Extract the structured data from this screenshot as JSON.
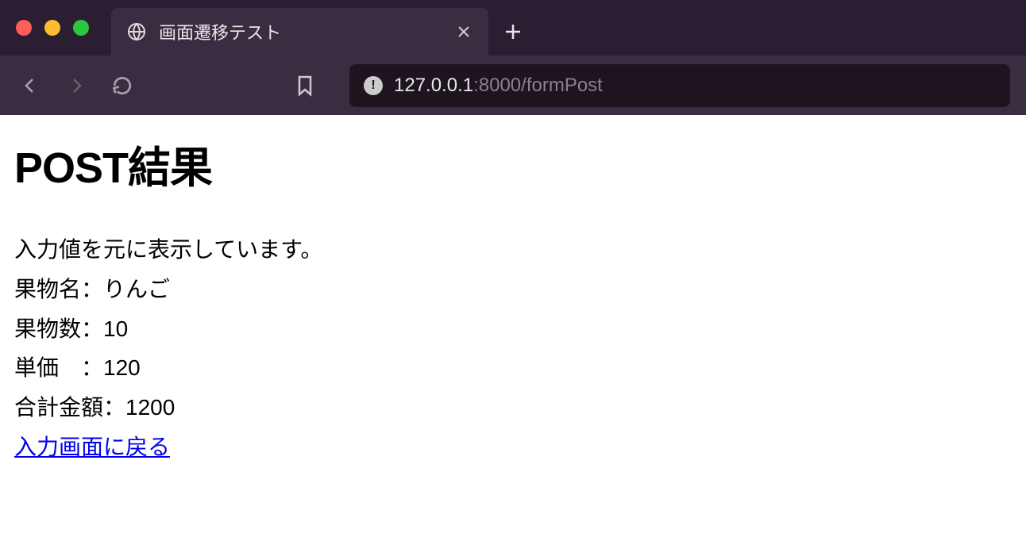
{
  "window": {
    "tab_title": "画面遷移テスト",
    "url_host": "127.0.0.1",
    "url_port_path": ":8000/formPost"
  },
  "page": {
    "heading": "POST結果",
    "intro": "入力値を元に表示しています。",
    "rows": {
      "fruit_name_label": "果物名：",
      "fruit_name_value": "りんご",
      "fruit_count_label": "果物数：",
      "fruit_count_value": "10",
      "unit_price_label": "単価　：",
      "unit_price_value": "120",
      "total_label": "合計金額：",
      "total_value": "1200"
    },
    "back_link": "入力画面に戻る"
  }
}
